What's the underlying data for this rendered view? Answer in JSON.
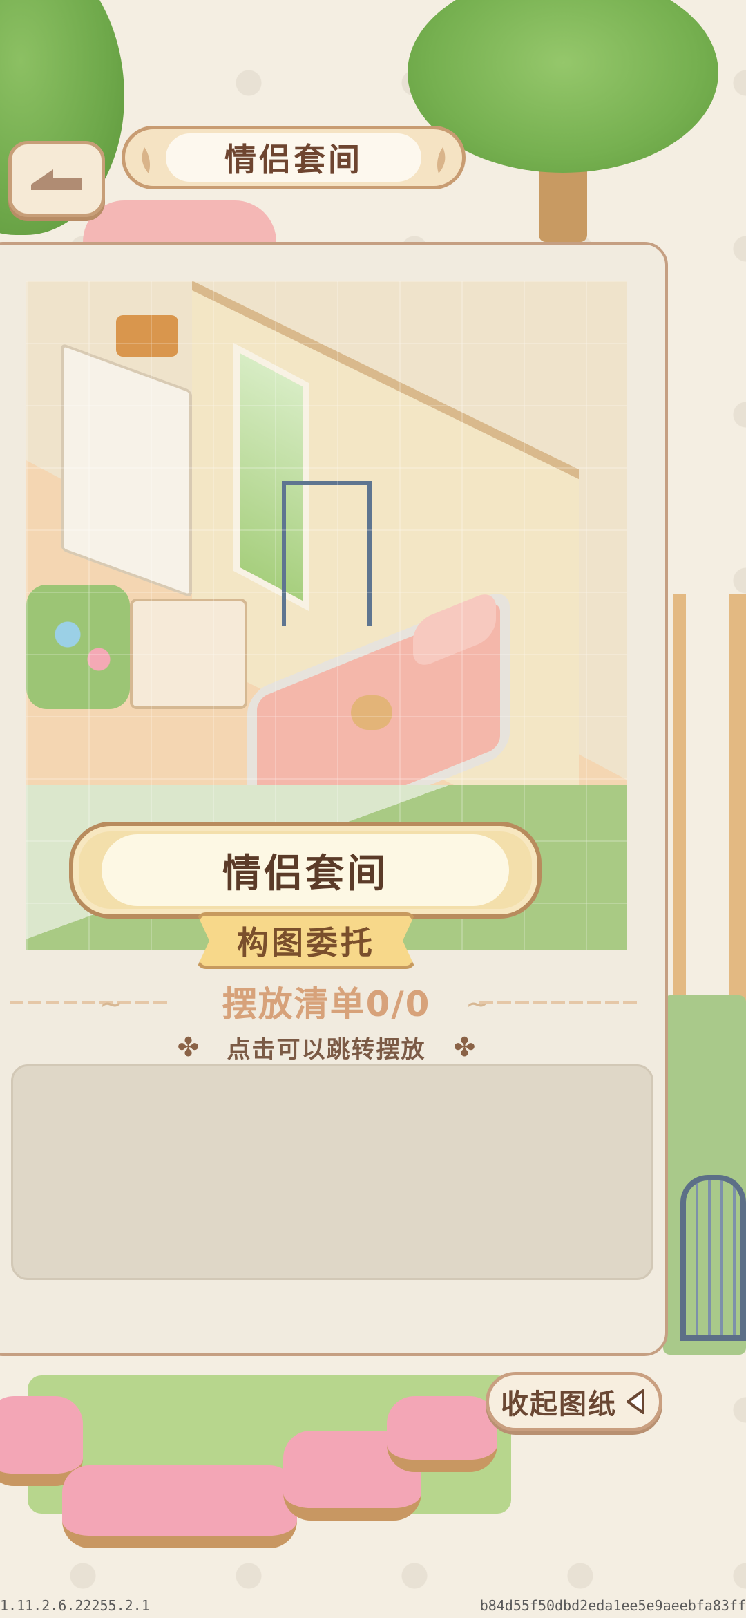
{
  "header": {
    "title": "情侣套间",
    "back_icon": "back-arrow-icon"
  },
  "blueprint": {
    "room_name": "情侣套间",
    "subtitle": "构图委托"
  },
  "placement_list": {
    "title": "摆放清单0/0",
    "placed": 0,
    "total": 0,
    "hint": "点击可以跳转摆放",
    "items": []
  },
  "collapse_button": {
    "label": "收起图纸",
    "icon": "triangle-left-icon"
  },
  "footer": {
    "version": "1.11.2.6.22255.2.1",
    "build_hash": "b84d55f50dbd2eda1ee5e9aeebfa83ff"
  },
  "colors": {
    "background": "#f4eee2",
    "card": "#f1ebdf",
    "card_border": "#c59f82",
    "title_text": "#6e4530",
    "list_title": "#d7a27a",
    "list_area": "#dfd7c7"
  }
}
